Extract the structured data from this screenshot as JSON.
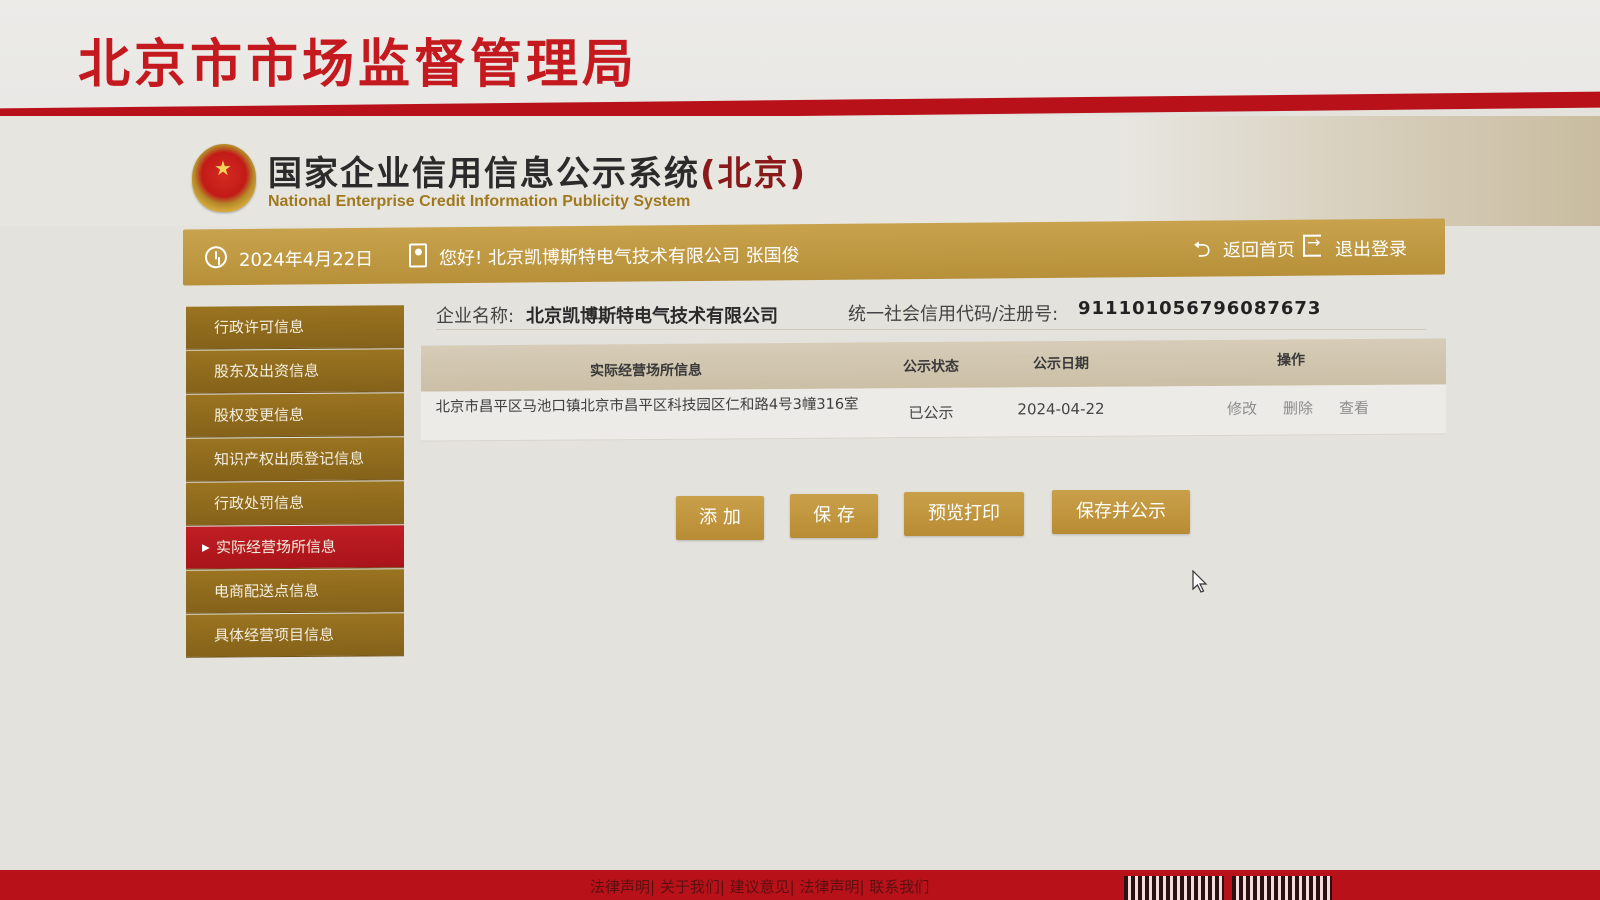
{
  "bureau": {
    "title": "北京市市场监督管理局"
  },
  "system": {
    "title_main": "国家企业信用信息公示系统",
    "title_region": "(北京)",
    "subtitle": "National Enterprise Credit Information Publicity System"
  },
  "info_bar": {
    "date": "2024年4月22日",
    "greeting": "您好! 北京凯博斯特电气技术有限公司  张国俊",
    "back_home": "返回首页",
    "logout": "退出登录"
  },
  "sidebar": {
    "items": [
      {
        "label": "行政许可信息",
        "active": false
      },
      {
        "label": "股东及出资信息",
        "active": false
      },
      {
        "label": "股权变更信息",
        "active": false
      },
      {
        "label": "知识产权出质登记信息",
        "active": false
      },
      {
        "label": "行政处罚信息",
        "active": false
      },
      {
        "label": "实际经营场所信息",
        "active": true
      },
      {
        "label": "电商配送点信息",
        "active": false
      },
      {
        "label": "具体经营项目信息",
        "active": false
      }
    ]
  },
  "company": {
    "name_label": "企业名称:",
    "name": "北京凯博斯特电气技术有限公司",
    "credit_label": "统一社会信用代码/注册号:",
    "credit_code": "911101056796087673"
  },
  "table": {
    "headers": {
      "address": "实际经营场所信息",
      "status": "公示状态",
      "date": "公示日期",
      "ops": "操作"
    },
    "rows": [
      {
        "address": "北京市昌平区马池口镇北京市昌平区科技园区仁和路4号3幢316室",
        "status": "已公示",
        "date": "2024-04-22",
        "op_edit": "修改",
        "op_delete": "删除",
        "op_view": "查看"
      }
    ]
  },
  "buttons": {
    "add": "添 加",
    "save": "保 存",
    "preview_print": "预览打印",
    "save_publish": "保存并公示"
  },
  "footer": {
    "links": "法律声明| 关于我们| 建议意见| 法律声明| 联系我们"
  },
  "colors": {
    "brand_red": "#c41a1f",
    "gold": "#b8903a",
    "sidebar_brown": "#8f6b1d"
  }
}
